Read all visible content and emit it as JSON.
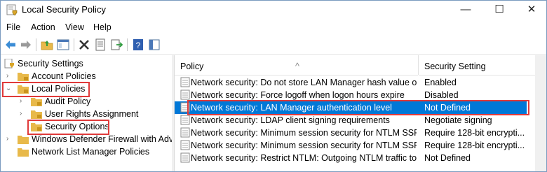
{
  "window": {
    "title": "Local Security Policy",
    "min_symbol": "—",
    "max_symbol": "☐",
    "close_symbol": "✕"
  },
  "menu": [
    "File",
    "Action",
    "View",
    "Help"
  ],
  "tree": {
    "root": "Security Settings",
    "items": [
      {
        "label": "Account Policies",
        "expanded": false
      },
      {
        "label": "Local Policies",
        "expanded": true
      },
      {
        "label": "Audit Policy"
      },
      {
        "label": "User Rights Assignment"
      },
      {
        "label": "Security Options",
        "selected": true
      },
      {
        "label": "Windows Defender Firewall with Adva"
      },
      {
        "label": "Network List Manager Policies"
      }
    ]
  },
  "list": {
    "columns": [
      "Policy",
      "Security Setting"
    ],
    "rows": [
      {
        "policy": "Network security: Do not store LAN Manager hash value on ...",
        "setting": "Enabled"
      },
      {
        "policy": "Network security: Force logoff when logon hours expire",
        "setting": "Disabled"
      },
      {
        "policy": "Network security: LAN Manager authentication level",
        "setting": "Not Defined",
        "selected": true
      },
      {
        "policy": "Network security: LDAP client signing requirements",
        "setting": "Negotiate signing"
      },
      {
        "policy": "Network security: Minimum session security for NTLM SSP ...",
        "setting": "Require 128-bit encrypti..."
      },
      {
        "policy": "Network security: Minimum session security for NTLM SSP ...",
        "setting": "Require 128-bit encrypti..."
      },
      {
        "policy": "Network security: Restrict NTLM: Outgoing NTLM traffic to r...",
        "setting": "Not Defined"
      }
    ]
  },
  "colors": {
    "selection": "#0078d7",
    "highlight_box": "#e03a3a",
    "folder": "#e8b94a"
  }
}
